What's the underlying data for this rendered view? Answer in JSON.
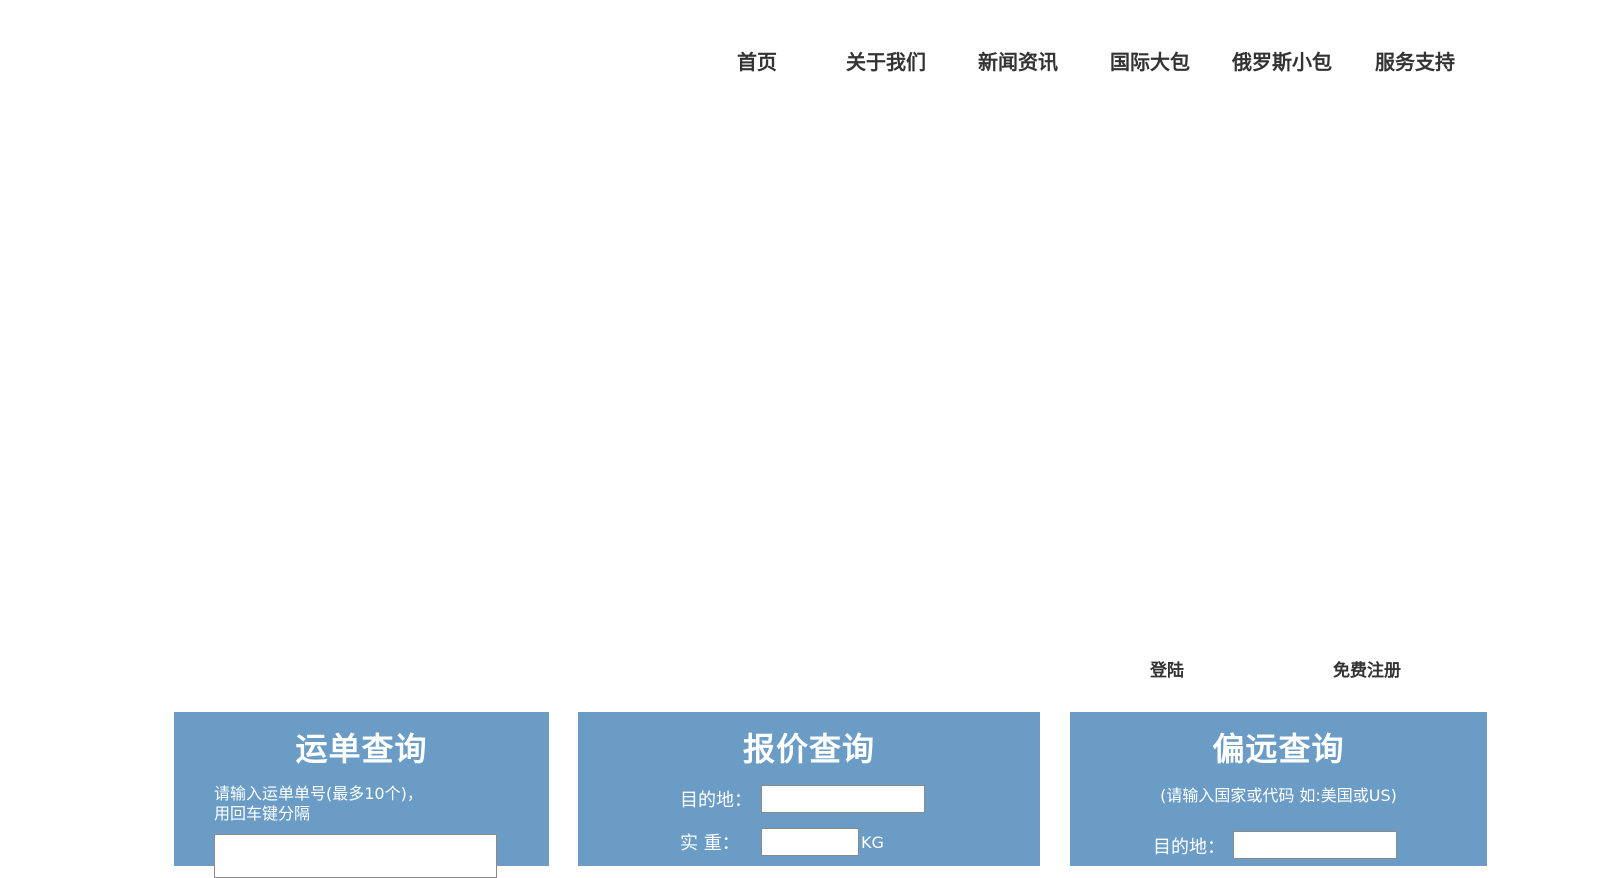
{
  "nav": {
    "items": [
      {
        "label": "首页"
      },
      {
        "label": "关于我们"
      },
      {
        "label": "新闻资讯"
      },
      {
        "label": "国际大包"
      },
      {
        "label": "俄罗斯小包"
      },
      {
        "label": "服务支持"
      }
    ]
  },
  "auth": {
    "login_label": "登陆",
    "register_label": "免费注册"
  },
  "tracking": {
    "title": "运单查询",
    "hint_line1": "请输入运单单号(最多10个)，",
    "hint_line2": "用回车键分隔",
    "input_value": ""
  },
  "quote": {
    "title": "报价查询",
    "destination_label": "目的地：",
    "destination_value": "",
    "weight_label": "实 重：",
    "weight_value": "",
    "weight_unit": "KG"
  },
  "remote": {
    "title": "偏远查询",
    "hint": "(请输入国家或代码 如:美国或US)",
    "destination_label": "目的地：",
    "destination_value": ""
  },
  "colors": {
    "panel_bg": "#6a9cc6",
    "nav_text": "#333333"
  }
}
